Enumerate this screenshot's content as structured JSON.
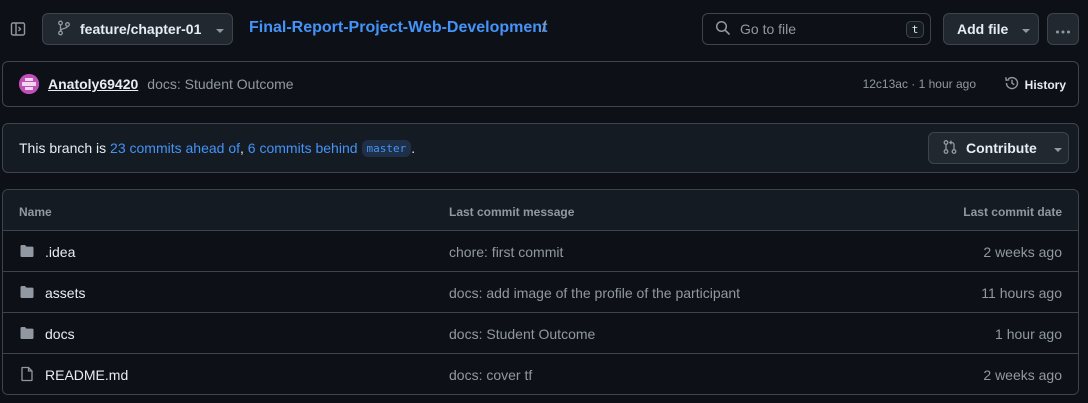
{
  "header": {
    "branch": "feature/chapter-01",
    "repo": "Final-Report-Project-Web-Development",
    "separator": "/",
    "search_placeholder": "Go to file",
    "search_shortcut": "t",
    "add_file_label": "Add file"
  },
  "commit": {
    "author": "Anatoly69420",
    "message": "docs: Student Outcome",
    "meta": "12c13ac · 1 hour ago",
    "history_label": "History"
  },
  "branch_status": {
    "prefix": "This branch is ",
    "ahead": "23 commits ahead of",
    "comma": ", ",
    "behind": "6 commits behind",
    "base": "master",
    "suffix": ".",
    "contribute_label": "Contribute"
  },
  "files": {
    "columns": [
      "Name",
      "Last commit message",
      "Last commit date"
    ],
    "rows": [
      {
        "name": ".idea",
        "type": "folder",
        "message": "chore: first commit",
        "date": "2 weeks ago"
      },
      {
        "name": "assets",
        "type": "folder",
        "message": "docs: add image of the profile of the participant",
        "date": "11 hours ago"
      },
      {
        "name": "docs",
        "type": "folder",
        "message": "docs: Student Outcome",
        "date": "1 hour ago"
      },
      {
        "name": "README.md",
        "type": "file",
        "message": "docs: cover tf",
        "date": "2 weeks ago"
      }
    ]
  },
  "colors": {
    "background": "#0d1117",
    "accent": "#4493f8",
    "muted": "#9198a1",
    "border": "#3d444d"
  },
  "icons": {
    "sidebar": "sidebar-toggle-icon",
    "branch": "git-branch-icon",
    "search": "search-icon",
    "history": "history-clock-icon",
    "contribute": "pull-request-icon",
    "folder": "folder-icon",
    "file": "file-icon"
  }
}
